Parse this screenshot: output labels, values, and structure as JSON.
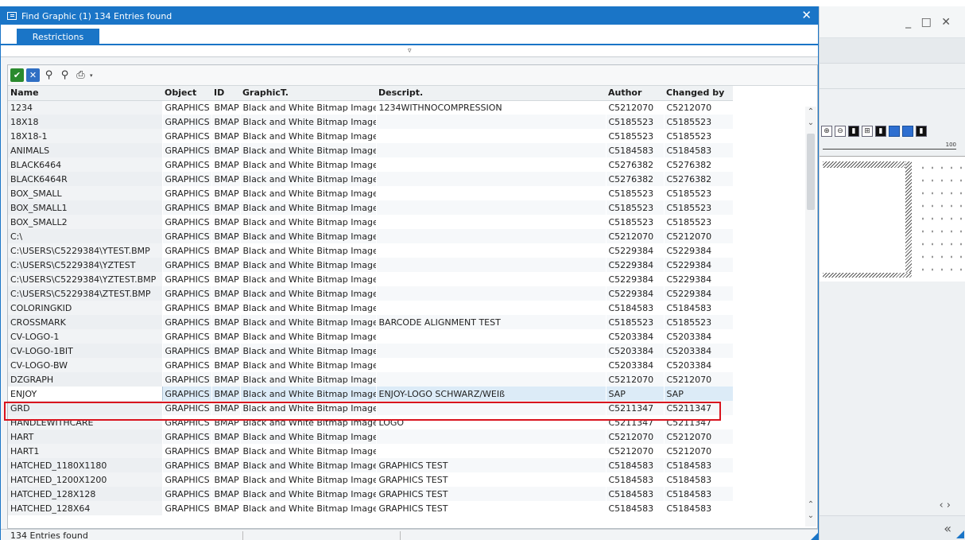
{
  "dialog": {
    "title": "Find Graphic (1)  134 Entries found",
    "tab": "Restrictions",
    "collapse_glyph": "▿",
    "status": "134 Entries found"
  },
  "toolbar": {
    "icons": [
      "checkmark-icon",
      "cancel-icon",
      "find-icon",
      "find-next-icon",
      "print-icon",
      "dropdown-caret-icon"
    ]
  },
  "table": {
    "columns": [
      "Name",
      "Object",
      "ID",
      "GraphicT.",
      "Descript.",
      "Author",
      "Changed by"
    ],
    "rows": [
      [
        "1234",
        "GRAPHICS",
        "BMAP",
        "Black and White Bitmap Image",
        "1234WITHNOCOMPRESSION",
        "C5212070",
        "C5212070"
      ],
      [
        "18X18",
        "GRAPHICS",
        "BMAP",
        "Black and White Bitmap Image",
        "",
        "C5185523",
        "C5185523"
      ],
      [
        "18X18-1",
        "GRAPHICS",
        "BMAP",
        "Black and White Bitmap Image",
        "",
        "C5185523",
        "C5185523"
      ],
      [
        "ANIMALS",
        "GRAPHICS",
        "BMAP",
        "Black and White Bitmap Image",
        "",
        "C5184583",
        "C5184583"
      ],
      [
        "BLACK6464",
        "GRAPHICS",
        "BMAP",
        "Black and White Bitmap Image",
        "",
        "C5276382",
        "C5276382"
      ],
      [
        "BLACK6464R",
        "GRAPHICS",
        "BMAP",
        "Black and White Bitmap Image",
        "",
        "C5276382",
        "C5276382"
      ],
      [
        "BOX_SMALL",
        "GRAPHICS",
        "BMAP",
        "Black and White Bitmap Image",
        "",
        "C5185523",
        "C5185523"
      ],
      [
        "BOX_SMALL1",
        "GRAPHICS",
        "BMAP",
        "Black and White Bitmap Image",
        "",
        "C5185523",
        "C5185523"
      ],
      [
        "BOX_SMALL2",
        "GRAPHICS",
        "BMAP",
        "Black and White Bitmap Image",
        "",
        "C5185523",
        "C5185523"
      ],
      [
        "C:\\",
        "GRAPHICS",
        "BMAP",
        "Black and White Bitmap Image",
        "",
        "C5212070",
        "C5212070"
      ],
      [
        "C:\\USERS\\C5229384\\YTEST.BMP",
        "GRAPHICS",
        "BMAP",
        "Black and White Bitmap Image",
        "",
        "C5229384",
        "C5229384"
      ],
      [
        "C:\\USERS\\C5229384\\YZTEST",
        "GRAPHICS",
        "BMAP",
        "Black and White Bitmap Image",
        "",
        "C5229384",
        "C5229384"
      ],
      [
        "C:\\USERS\\C5229384\\YZTEST.BMP",
        "GRAPHICS",
        "BMAP",
        "Black and White Bitmap Image",
        "",
        "C5229384",
        "C5229384"
      ],
      [
        "C:\\USERS\\C5229384\\ZTEST.BMP",
        "GRAPHICS",
        "BMAP",
        "Black and White Bitmap Image",
        "",
        "C5229384",
        "C5229384"
      ],
      [
        "COLORINGKID",
        "GRAPHICS",
        "BMAP",
        "Black and White Bitmap Image",
        "",
        "C5184583",
        "C5184583"
      ],
      [
        "CROSSMARK",
        "GRAPHICS",
        "BMAP",
        "Black and White Bitmap Image",
        "BARCODE ALIGNMENT TEST",
        "C5185523",
        "C5185523"
      ],
      [
        "CV-LOGO-1",
        "GRAPHICS",
        "BMAP",
        "Black and White Bitmap Image",
        "",
        "C5203384",
        "C5203384"
      ],
      [
        "CV-LOGO-1BIT",
        "GRAPHICS",
        "BMAP",
        "Black and White Bitmap Image",
        "",
        "C5203384",
        "C5203384"
      ],
      [
        "CV-LOGO-BW",
        "GRAPHICS",
        "BMAP",
        "Black and White Bitmap Image",
        "",
        "C5203384",
        "C5203384"
      ],
      [
        "DZGRAPH",
        "GRAPHICS",
        "BMAP",
        "Black and White Bitmap Image",
        "",
        "C5212070",
        "C5212070"
      ],
      [
        "ENJOY",
        "GRAPHICS",
        "BMAP",
        "Black and White Bitmap Image",
        "ENJOY-LOGO SCHWARZ/WEIß",
        "SAP",
        "SAP"
      ],
      [
        "GRD",
        "GRAPHICS",
        "BMAP",
        "Black and White Bitmap Image",
        "",
        "C5211347",
        "C5211347"
      ],
      [
        "HANDLEWITHCARE",
        "GRAPHICS",
        "BMAP",
        "Black and White Bitmap Image",
        "LOGO",
        "C5211347",
        "C5211347"
      ],
      [
        "HART",
        "GRAPHICS",
        "BMAP",
        "Black and White Bitmap Image",
        "",
        "C5212070",
        "C5212070"
      ],
      [
        "HART1",
        "GRAPHICS",
        "BMAP",
        "Black and White Bitmap Image",
        "",
        "C5212070",
        "C5212070"
      ],
      [
        "HATCHED_1180X1180",
        "GRAPHICS",
        "BMAP",
        "Black and White Bitmap Image",
        "GRAPHICS TEST",
        "C5184583",
        "C5184583"
      ],
      [
        "HATCHED_1200X1200",
        "GRAPHICS",
        "BMAP",
        "Black and White Bitmap Image",
        "GRAPHICS TEST",
        "C5184583",
        "C5184583"
      ],
      [
        "HATCHED_128X128",
        "GRAPHICS",
        "BMAP",
        "Black and White Bitmap Image",
        "GRAPHICS TEST",
        "C5184583",
        "C5184583"
      ],
      [
        "HATCHED_128X64",
        "GRAPHICS",
        "BMAP",
        "Black and White Bitmap Image",
        "GRAPHICS TEST",
        "C5184583",
        "C5184583"
      ]
    ],
    "selected_index": 20
  },
  "background_window": {
    "window_controls": "_ □ ✕",
    "ruler_label": "100",
    "nav_arrows": "‹ ›",
    "collapse_glyph": "«"
  },
  "colors": {
    "accent": "#1a75c7",
    "highlight_border": "#d9141e",
    "ok_green": "#2a8a2e"
  }
}
